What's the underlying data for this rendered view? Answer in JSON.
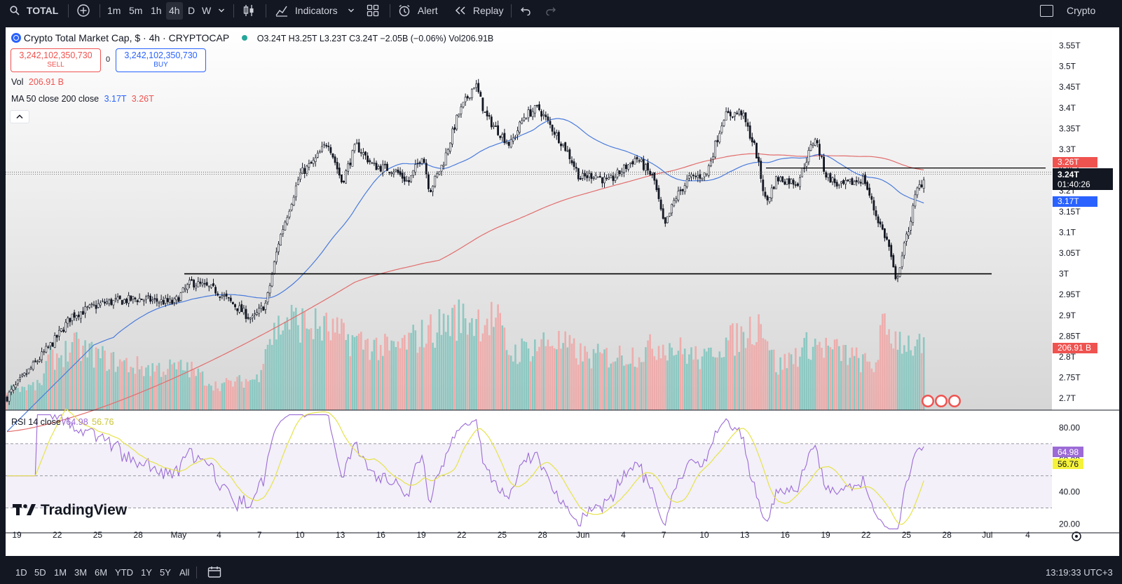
{
  "toolbar": {
    "symbol": "TOTAL",
    "intervals": [
      "1m",
      "5m",
      "1h",
      "4h",
      "D",
      "W"
    ],
    "active_interval": "4h",
    "indicators_label": "Indicators",
    "alert_label": "Alert",
    "replay_label": "Replay",
    "right_label": "Crypto"
  },
  "legend": {
    "title": "Crypto Total Market Cap, $ · 4h · CRYPTOCAP",
    "ohlc": "O3.24T  H3.25T  L3.23T  C3.24T  −2.05B (−0.06%)  Vol206.91B",
    "sell_price": "3,242,102,350,730",
    "sell_label": "SELL",
    "spread": "0",
    "buy_price": "3,242,102,350,730",
    "buy_label": "BUY",
    "vol_label": "Vol",
    "vol_value": "206.91 B",
    "ma_label": "MA 50 close 200 close",
    "ma50_value": "3.17T",
    "ma200_value": "3.26T",
    "rsi_label": "RSI 14 close",
    "rsi_value": "64.98",
    "rsi_ma_value": "56.76"
  },
  "price_axis": {
    "ticks": [
      "3.55T",
      "3.5T",
      "3.45T",
      "3.4T",
      "3.35T",
      "3.3T",
      "3.25T",
      "3.2T",
      "3.15T",
      "3.1T",
      "3.05T",
      "3T",
      "2.95T",
      "2.9T",
      "2.85T",
      "2.8T",
      "2.75T",
      "2.7T"
    ],
    "tags": {
      "ma200": "3.26T",
      "last": "3.24T",
      "countdown": "01:40:26",
      "ma50": "3.17T",
      "volume": "206.91 B"
    }
  },
  "rsi_axis": {
    "ticks": [
      "80.00",
      "60.00",
      "40.00",
      "20.00"
    ],
    "tags": {
      "rsi": "64.98",
      "rsi_ma": "56.76"
    }
  },
  "time_axis": {
    "labels": [
      "19",
      "22",
      "25",
      "28",
      "May",
      "4",
      "7",
      "10",
      "13",
      "16",
      "19",
      "22",
      "25",
      "28",
      "Jun",
      "4",
      "7",
      "10",
      "13",
      "16",
      "19",
      "22",
      "25",
      "28",
      "Jul",
      "4"
    ]
  },
  "watermark": "TradingView",
  "range_buttons": [
    "1D",
    "5D",
    "1M",
    "3M",
    "6M",
    "YTD",
    "1Y",
    "5Y",
    "All"
  ],
  "clock": "13:19:33 UTC+3",
  "colors": {
    "up": "#26a69a",
    "down": "#ef5350",
    "ma50": "#4a7bdc",
    "ma200": "#e26d6d",
    "rsi": "#9c6bd6",
    "rsi_ma": "#e6e34a",
    "accent": "#2962ff"
  },
  "chart_data": {
    "type": "candlestick",
    "series": [
      {
        "name": "Crypto Total Market Cap",
        "points": [
          {
            "t": "Apr 19",
            "c": 2.7
          },
          {
            "t": "Apr 22",
            "c": 2.84
          },
          {
            "t": "Apr 25",
            "c": 2.93
          },
          {
            "t": "Apr 28",
            "c": 2.94
          },
          {
            "t": "May 1",
            "c": 2.96
          },
          {
            "t": "May 4",
            "c": 2.98
          },
          {
            "t": "May 6",
            "c": 2.91
          },
          {
            "t": "May 8",
            "c": 3.1
          },
          {
            "t": "May 10",
            "c": 3.25
          },
          {
            "t": "May 12",
            "c": 3.31
          },
          {
            "t": "May 14",
            "c": 3.3
          },
          {
            "t": "May 17",
            "c": 3.26
          },
          {
            "t": "May 19",
            "c": 3.28
          },
          {
            "t": "May 22",
            "c": 3.47
          },
          {
            "t": "May 24",
            "c": 3.36
          },
          {
            "t": "May 27",
            "c": 3.39
          },
          {
            "t": "May 30",
            "c": 3.24
          },
          {
            "t": "Jun 2",
            "c": 3.25
          },
          {
            "t": "Jun 4",
            "c": 3.28
          },
          {
            "t": "Jun 6",
            "c": 3.13
          },
          {
            "t": "Jun 8",
            "c": 3.25
          },
          {
            "t": "Jun 10",
            "c": 3.39
          },
          {
            "t": "Jun 12",
            "c": 3.32
          },
          {
            "t": "Jun 14",
            "c": 3.22
          },
          {
            "t": "Jun 16",
            "c": 3.31
          },
          {
            "t": "Jun 18",
            "c": 3.21
          },
          {
            "t": "Jun 20",
            "c": 3.22
          },
          {
            "t": "Jun 22",
            "c": 3.0
          },
          {
            "t": "Jun 23",
            "c": 3.02
          },
          {
            "t": "Jun 24",
            "c": 3.2
          },
          {
            "t": "Jun 25",
            "c": 3.24
          }
        ]
      },
      {
        "name": "MA 50 close",
        "last": 3.17
      },
      {
        "name": "MA 200 close",
        "last": 3.26
      },
      {
        "name": "RSI 14 close",
        "last": 64.98
      },
      {
        "name": "RSI MA",
        "last": 56.76
      }
    ],
    "horizontal_lines": [
      3.0,
      3.24
    ],
    "ylim": [
      2.69,
      3.57
    ],
    "rsi_ylim": [
      15,
      90
    ]
  }
}
